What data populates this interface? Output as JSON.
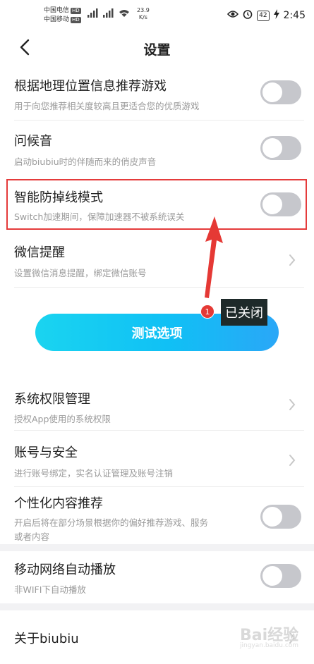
{
  "status_bar": {
    "carrier1": "中国电信",
    "carrier2": "中国移动",
    "hd_label": "HD",
    "net_speed_value": "23.9",
    "net_speed_unit": "K/s",
    "battery": "42",
    "time": "2:45"
  },
  "header": {
    "title": "设置"
  },
  "settings": [
    {
      "title": "根据地理位置信息推荐游戏",
      "subtitle": "用于向您推荐相关度较高且更适合您的优质游戏",
      "control": "toggle",
      "on": false
    },
    {
      "title": "问候音",
      "subtitle": "启动biubiu时的伴随而来的俏皮声音",
      "control": "toggle",
      "on": false
    },
    {
      "title": "智能防掉线模式",
      "subtitle": "Switch加速期间，保障加速器不被系统误关",
      "control": "toggle",
      "on": false
    },
    {
      "title": "微信提醒",
      "subtitle": "设置微信消息提醒，绑定微信账号",
      "control": "chevron"
    },
    {
      "title": "系统权限管理",
      "subtitle": "授权App使用的系统权限",
      "control": "chevron"
    },
    {
      "title": "账号与安全",
      "subtitle": "进行账号绑定，实名认证管理及账号注销",
      "control": "chevron"
    },
    {
      "title": "个性化内容推荐",
      "subtitle_line1": "开启后将在部分场景根据你的偏好推荐游戏、服务",
      "subtitle_line2": "或者内容",
      "control": "toggle",
      "on": false
    },
    {
      "title": "移动网络自动播放",
      "subtitle": "非WIFI下自动播放",
      "control": "toggle",
      "on": false
    },
    {
      "title": "关于biubiu",
      "control": "chevron"
    }
  ],
  "test_button": {
    "label": "测试选项"
  },
  "annotation": {
    "step_number": "1",
    "tooltip": "已关闭",
    "arrow_color": "#e53935",
    "box_color": "#e53b3b"
  },
  "watermark": {
    "text": "Bai经验",
    "sub": "jingyan.baidu.com"
  },
  "colors": {
    "toggle_off": "#c6c7cc",
    "button_gradient_start": "#1ad4f0",
    "button_gradient_end": "#2aa7f7"
  }
}
